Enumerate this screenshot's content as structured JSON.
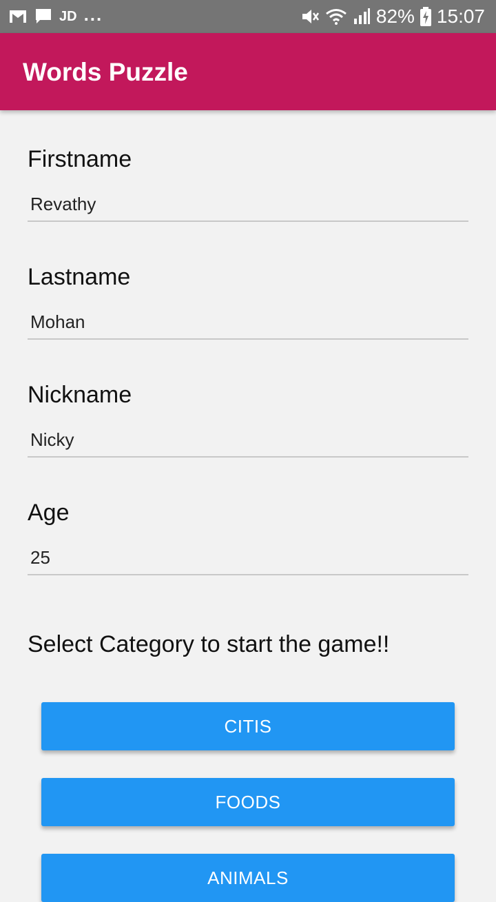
{
  "status_bar": {
    "left_app_label": "JD",
    "more": "...",
    "battery": "82%",
    "time": "15:07",
    "icons": [
      "gmail-icon",
      "message-icon",
      "mute-icon",
      "wifi-icon",
      "signal-icon",
      "battery-charging-icon"
    ]
  },
  "app_bar": {
    "title": "Words Puzzle",
    "color": "#c2185b"
  },
  "form": {
    "fields": [
      {
        "label": "Firstname",
        "value": "Revathy"
      },
      {
        "label": "Lastname",
        "value": "Mohan"
      },
      {
        "label": "Nickname",
        "value": "Nicky"
      },
      {
        "label": "Age",
        "value": "25"
      }
    ]
  },
  "prompt": "Select Category to start the game!!",
  "categories": {
    "color": "#2196f3",
    "buttons": [
      {
        "label": "CITIS"
      },
      {
        "label": "FOODS"
      },
      {
        "label": "ANIMALS"
      }
    ]
  }
}
